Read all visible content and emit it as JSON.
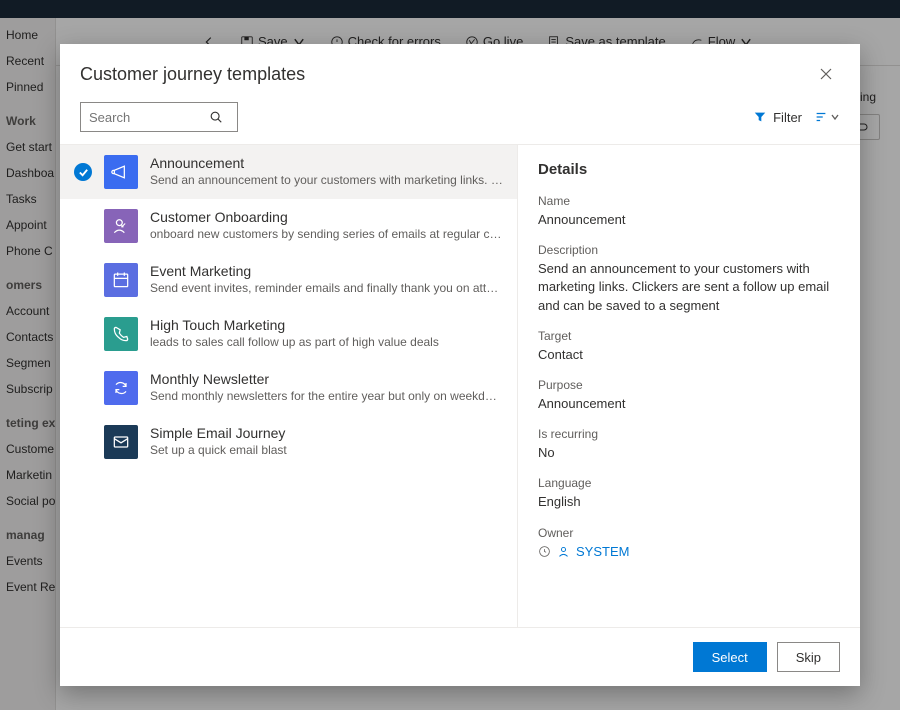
{
  "topbar": {
    "save": "Save",
    "check": "Check for errors",
    "golive": "Go live",
    "saveas": "Save as template",
    "flow": "Flow"
  },
  "sidebar": {
    "items": [
      "Home",
      "Recent",
      "Pinned"
    ],
    "work_hdr": "Work",
    "work": [
      "Get start",
      "Dashboa",
      "Tasks",
      "Appoint",
      "Phone C"
    ],
    "cust_hdr": "omers",
    "cust": [
      "Account",
      "Contacts",
      "Segmen",
      "Subscrip"
    ],
    "exec_hdr": "teting ex",
    "exec": [
      "Custome",
      "Marketin",
      "Social po"
    ],
    "mgmt_hdr": "manag",
    "mgmt": [
      "Events",
      "Event Registrations"
    ]
  },
  "bg_form_label": "rring",
  "modal": {
    "title": "Customer journey templates",
    "search_placeholder": "Search",
    "filter_label": "Filter",
    "select_label": "Select",
    "skip_label": "Skip"
  },
  "templates": [
    {
      "title": "Announcement",
      "desc": "Send an announcement to your customers with marketing links. Clickers are sent a...",
      "color": "ic-blue",
      "icon": "megaphone",
      "selected": true
    },
    {
      "title": "Customer Onboarding",
      "desc": "onboard new customers by sending series of emails at regular cadence",
      "color": "ic-purple",
      "icon": "person",
      "selected": false
    },
    {
      "title": "Event Marketing",
      "desc": "Send event invites, reminder emails and finally thank you on attending",
      "color": "ic-cal",
      "icon": "calendar",
      "selected": false
    },
    {
      "title": "High Touch Marketing",
      "desc": "leads to sales call follow up as part of high value deals",
      "color": "ic-teal",
      "icon": "phone",
      "selected": false
    },
    {
      "title": "Monthly Newsletter",
      "desc": "Send monthly newsletters for the entire year but only on weekday afternoons",
      "color": "ic-sync",
      "icon": "sync",
      "selected": false
    },
    {
      "title": "Simple Email Journey",
      "desc": "Set up a quick email blast",
      "color": "ic-mail",
      "icon": "mail",
      "selected": false
    }
  ],
  "details": {
    "header": "Details",
    "labels": {
      "name": "Name",
      "description": "Description",
      "target": "Target",
      "purpose": "Purpose",
      "recurring": "Is recurring",
      "language": "Language",
      "owner": "Owner"
    },
    "name": "Announcement",
    "description": "Send an announcement to your customers with marketing links. Clickers are sent a follow up email and can be saved to a segment",
    "target": "Contact",
    "purpose": "Announcement",
    "recurring": "No",
    "language": "English",
    "owner": "SYSTEM"
  }
}
